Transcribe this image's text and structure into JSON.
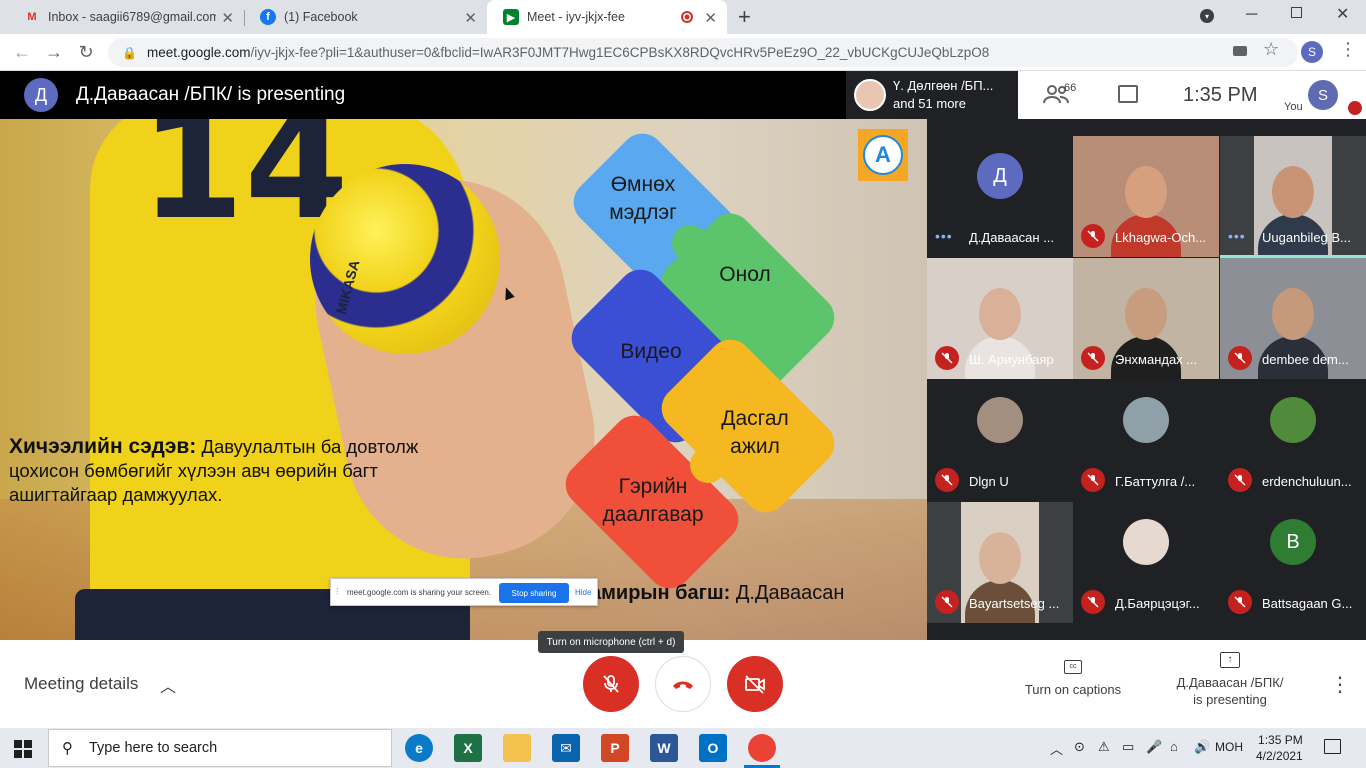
{
  "browser": {
    "tabs": [
      {
        "title": "Inbox - saagii6789@gmail.com -",
        "icon": "gmail-icon"
      },
      {
        "title": "(1) Facebook",
        "icon": "facebook-icon"
      },
      {
        "title": "Meet - iyv-jkjx-fee",
        "icon": "meet-icon",
        "active": true
      }
    ],
    "new_tab": "+",
    "url_host": "meet.google.com",
    "url_path": "/iyv-jkjx-fee?pli=1&authuser=0&fbclid=IwAR3F0JMT7Hwg1EC6CPBsKX8RDQvcHRv5PeEz9O_22_vbUCKgCUJeQbLzpO8",
    "profile_initial": "S"
  },
  "meet": {
    "presenter_initial": "Д",
    "presenting_title": "Д.Даваасан /БПК/ is presenting",
    "strip_name": "Ү. Дөлгөөн /БП...",
    "strip_more": "and 51 more",
    "participants_count": "66",
    "clock": "1:35 PM",
    "you_label": "You",
    "you_initial": "S"
  },
  "slide": {
    "logo_letter": "A",
    "ball_brand": "MIKASA",
    "jersey_number": "14",
    "puzzle": [
      {
        "label": "Өмнөх\nмэдлэг",
        "color": "#5aa9f0"
      },
      {
        "label": "Онол",
        "color": "#5cc46a"
      },
      {
        "label": "Видео",
        "color": "#3b4fd4"
      },
      {
        "label": "Дасгал\nажил",
        "color": "#f5b820"
      },
      {
        "label": "Гэрийн\nдаалгавар",
        "color": "#f0503a"
      }
    ],
    "topic_label": "Хичээлийн сэдэв:",
    "topic_text": "Давуулалтын ба довтолж цохисон бөмбөгийг хүлээн авч өөрийн багт ашигтайгаар дамжуулах.",
    "teacher_label": "амирын багш:",
    "teacher_name": "Д.Даваасан"
  },
  "share_banner": {
    "text": "meet.google.com is sharing your screen.",
    "stop": "Stop sharing",
    "hide": "Hide"
  },
  "participants": [
    {
      "name": "Д.Даваасан ...",
      "initial": "Д",
      "color": "#5c6bc0",
      "status": "speaking",
      "video": false
    },
    {
      "name": "Lkhagwa-Och...",
      "status": "muted",
      "video": true,
      "bg": "#b98e78",
      "skin": "#d6a07f",
      "shirt": "#c0392b"
    },
    {
      "name": "Uuganbileg B...",
      "status": "speaking",
      "video": true,
      "bg": "#c9c3bf",
      "skin": "#c89475",
      "shirt": "#2f3a4a"
    },
    {
      "name": "Ш. Ариунбаяр",
      "status": "muted",
      "video": true,
      "bg": "#d8cfc8",
      "skin": "#d9b198",
      "shirt": "#e9e4e0"
    },
    {
      "name": "Энхмандах ...",
      "status": "muted",
      "video": true,
      "bg": "#c1b4a3",
      "skin": "#c79c7f",
      "shirt": "#1f1f1f"
    },
    {
      "name": "dembee dem...",
      "status": "muted",
      "video": true,
      "bg": "#8c9096",
      "skin": "#c49a7a",
      "shirt": "#2b2f3a"
    },
    {
      "name": "Dlgn U",
      "initial": "",
      "color": "#a38f80",
      "status": "muted",
      "video": false
    },
    {
      "name": "Г.Баттулга /...",
      "initial": "",
      "color": "#8fa0a8",
      "status": "muted",
      "video": false
    },
    {
      "name": "erdenchuluun...",
      "initial": "",
      "color": "#4f8b3a",
      "status": "muted",
      "video": false
    },
    {
      "name": "Bayartsetseg ...",
      "status": "muted",
      "video": true,
      "bg": "#d9cfc2",
      "skin": "#d8b39a",
      "shirt": "#6b4f3a"
    },
    {
      "name": "Д.Баярцэцэг...",
      "initial": "",
      "color": "#e6d9d0",
      "status": "muted",
      "video": false
    },
    {
      "name": "Battsagaan G...",
      "initial": "B",
      "color": "#2e7d32",
      "status": "muted",
      "video": false
    }
  ],
  "controls": {
    "meeting_details": "Meeting details",
    "tooltip": "Turn on microphone (ctrl + d)",
    "captions": "Turn on captions",
    "presenting": "Д.Даваасан /БПК/\nis presenting"
  },
  "taskbar": {
    "search_placeholder": "Type here to search",
    "apps": [
      {
        "name": "edge",
        "label": "e",
        "color": "#0a7bc9"
      },
      {
        "name": "excel",
        "label": "X",
        "color": "#1e7145"
      },
      {
        "name": "file-explorer",
        "label": "",
        "color": "#f2c14e"
      },
      {
        "name": "mail",
        "label": "✉",
        "color": "#0a64ad"
      },
      {
        "name": "powerpoint",
        "label": "P",
        "color": "#d24726"
      },
      {
        "name": "word",
        "label": "W",
        "color": "#2b5797"
      },
      {
        "name": "outlook",
        "label": "O",
        "color": "#0072c6"
      },
      {
        "name": "chrome",
        "label": "",
        "color": "#ea4335"
      }
    ],
    "language": "МОН",
    "time": "1:35 PM",
    "date": "4/2/2021"
  }
}
